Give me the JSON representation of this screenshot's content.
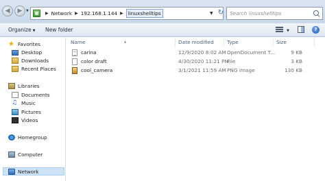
{
  "address": {
    "crumbs": [
      "Network",
      "192.168.1.144",
      "linuxshelltips"
    ],
    "search_placeholder": "Search linuxshelltips"
  },
  "toolbar": {
    "organize_label": "Organize",
    "new_folder_label": "New folder"
  },
  "nav": {
    "favorites": "Favorites",
    "desktop": "Desktop",
    "downloads": "Downloads",
    "recent": "Recent Places",
    "libraries": "Libraries",
    "documents": "Documents",
    "music": "Music",
    "pictures": "Pictures",
    "videos": "Videos",
    "homegroup": "Homegroup",
    "computer": "Computer",
    "network": "Network"
  },
  "columns": {
    "name": "Name",
    "date": "Date modified",
    "type": "Type",
    "size": "Size"
  },
  "files": [
    {
      "name": "carina",
      "date": "12/9/2020 8:02 AM",
      "type": "OpenDocument T...",
      "size": "9 KB",
      "icon": "document-icon"
    },
    {
      "name": "color draft",
      "date": "4/30/2020 11:21 PM",
      "type": "File",
      "size": "3 KB",
      "icon": "file-icon"
    },
    {
      "name": "cool_camera",
      "date": "3/1/2021 11:59 AM",
      "type": "PNG image",
      "size": "130 KB",
      "icon": "image-icon"
    }
  ]
}
